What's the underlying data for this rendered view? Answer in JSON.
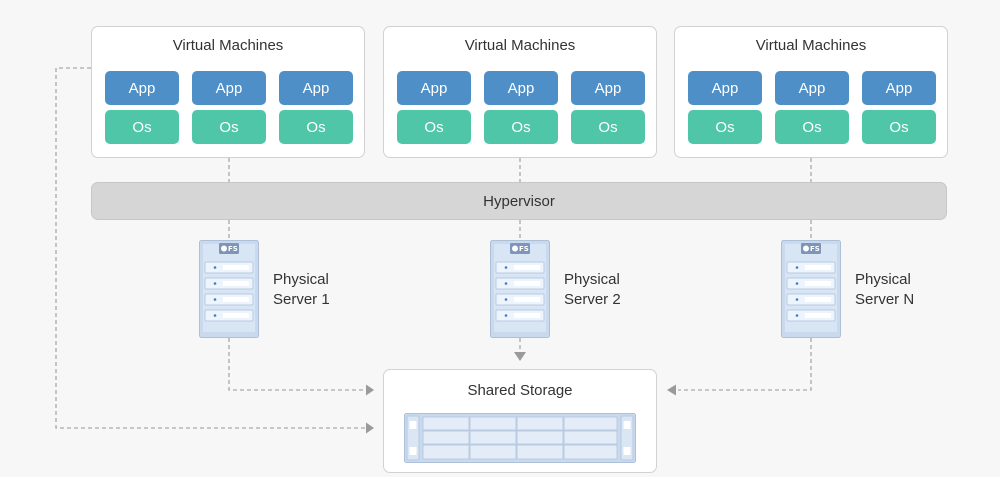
{
  "diagram": {
    "vm_groups": [
      {
        "title": "Virtual Machines",
        "vms": [
          {
            "app": "App",
            "os": "Os"
          },
          {
            "app": "App",
            "os": "Os"
          },
          {
            "app": "App",
            "os": "Os"
          }
        ]
      },
      {
        "title": "Virtual Machines",
        "vms": [
          {
            "app": "App",
            "os": "Os"
          },
          {
            "app": "App",
            "os": "Os"
          },
          {
            "app": "App",
            "os": "Os"
          }
        ]
      },
      {
        "title": "Virtual Machines",
        "vms": [
          {
            "app": "App",
            "os": "Os"
          },
          {
            "app": "App",
            "os": "Os"
          },
          {
            "app": "App",
            "os": "Os"
          }
        ]
      }
    ],
    "hypervisor": {
      "label": "Hypervisor"
    },
    "servers": [
      {
        "line1": "Physical",
        "line2": "Server 1",
        "badge": "FS"
      },
      {
        "line1": "Physical",
        "line2": "Server 2",
        "badge": "FS"
      },
      {
        "line1": "Physical",
        "line2": "Server N",
        "badge": "FS"
      }
    ],
    "storage": {
      "title": "Shared Storage"
    }
  },
  "colors": {
    "app": "#4d8fc6",
    "os": "#4fc6a8",
    "hypervisor": "#d6d6d6",
    "server": "#c9d9ee",
    "connector": "#a9a9a9"
  },
  "icons": [
    "server-icon",
    "storage-array-icon",
    "fs-badge-icon",
    "arrow-right-icon",
    "arrow-left-icon",
    "arrow-down-icon"
  ]
}
